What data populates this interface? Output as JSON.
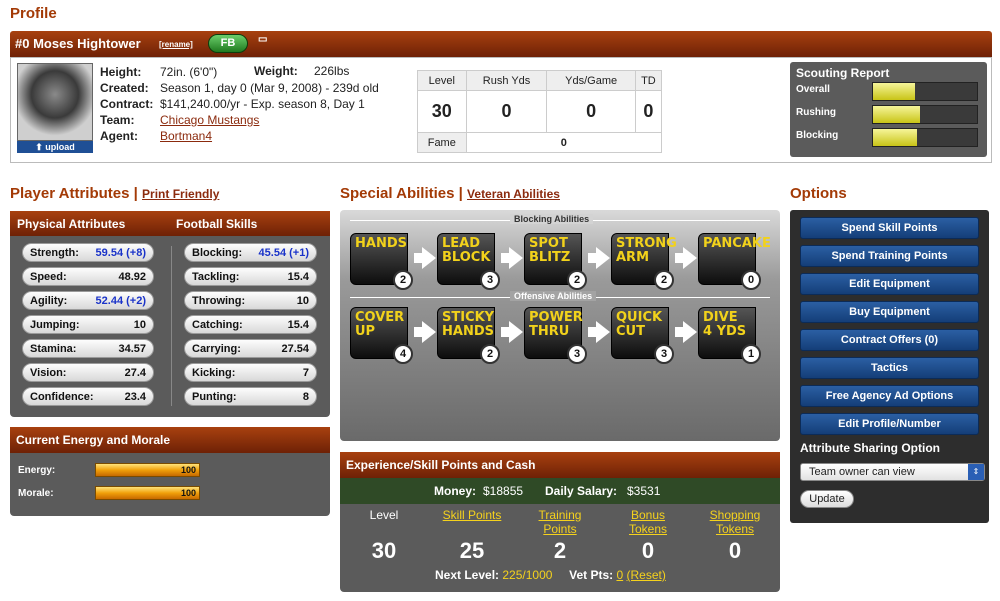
{
  "page_title": "Profile",
  "player": {
    "name": "#0 Moses Hightower",
    "rename": "[rename]",
    "position": "FB",
    "height_label": "Height:",
    "height": "72in. (6'0\")",
    "weight_label": "Weight:",
    "weight": "226lbs",
    "created_label": "Created:",
    "created": "Season 1, day 0 (Mar 9, 2008) - 239d old",
    "contract_label": "Contract:",
    "contract": "$141,240.00/yr - Exp. season 8, Day 1",
    "team_label": "Team:",
    "team": "Chicago Mustangs",
    "agent_label": "Agent:",
    "agent": "Bortman4",
    "upload": "upload"
  },
  "stats": {
    "headers": [
      "Level",
      "Rush Yds",
      "Yds/Game",
      "TD"
    ],
    "values": [
      "30",
      "0",
      "0",
      "0"
    ],
    "fame_label": "Fame",
    "fame": "0"
  },
  "scouting": {
    "title": "Scouting Report",
    "rows": [
      {
        "label": "Overall",
        "level": 0.4
      },
      {
        "label": "Rushing",
        "level": 0.45
      },
      {
        "label": "Blocking",
        "level": 0.42
      }
    ]
  },
  "attributes": {
    "title": "Player Attributes",
    "print": "Print Friendly",
    "physical_title": "Physical Attributes",
    "skills_title": "Football Skills",
    "physical": [
      {
        "label": "Strength:",
        "value": "59.54 (+8)",
        "blue": true
      },
      {
        "label": "Speed:",
        "value": "48.92"
      },
      {
        "label": "Agility:",
        "value": "52.44 (+2)",
        "blue": true
      },
      {
        "label": "Jumping:",
        "value": "10"
      },
      {
        "label": "Stamina:",
        "value": "34.57"
      },
      {
        "label": "Vision:",
        "value": "27.4"
      },
      {
        "label": "Confidence:",
        "value": "23.4"
      }
    ],
    "skills": [
      {
        "label": "Blocking:",
        "value": "45.54 (+1)",
        "blue": true
      },
      {
        "label": "Tackling:",
        "value": "15.4"
      },
      {
        "label": "Throwing:",
        "value": "10"
      },
      {
        "label": "Catching:",
        "value": "15.4"
      },
      {
        "label": "Carrying:",
        "value": "27.54"
      },
      {
        "label": "Kicking:",
        "value": "7"
      },
      {
        "label": "Punting:",
        "value": "8"
      }
    ]
  },
  "energy": {
    "title": "Current Energy and Morale",
    "energy_label": "Energy:",
    "energy": "100",
    "morale_label": "Morale:",
    "morale": "100"
  },
  "abilities": {
    "title": "Special Abilities",
    "veteran": "Veteran Abilities",
    "blocking_title": "Blocking Abilities",
    "offensive_title": "Offensive Abilities",
    "blocking": [
      {
        "l1": "Hands",
        "l2": "",
        "n": "2"
      },
      {
        "l1": "Lead",
        "l2": "Block",
        "n": "3"
      },
      {
        "l1": "Spot",
        "l2": "Blitz",
        "n": "2"
      },
      {
        "l1": "Strong",
        "l2": "Arm",
        "n": "2"
      },
      {
        "l1": "Pancake",
        "l2": "",
        "n": "0"
      }
    ],
    "offensive": [
      {
        "l1": "Cover",
        "l2": "Up",
        "n": "4"
      },
      {
        "l1": "Sticky",
        "l2": "Hands",
        "n": "2"
      },
      {
        "l1": "Power",
        "l2": "Thru",
        "n": "3"
      },
      {
        "l1": "Quick",
        "l2": "Cut",
        "n": "3"
      },
      {
        "l1": "Dive",
        "l2": "4 Yds",
        "n": "1"
      }
    ]
  },
  "experience": {
    "title": "Experience/Skill Points and Cash",
    "money_label": "Money:",
    "money": "$18855",
    "salary_label": "Daily Salary:",
    "salary": "$3531",
    "level_label": "Level",
    "skill_label": "Skill Points",
    "training_label1": "Training",
    "training_label2": "Points",
    "bonus_label1": "Bonus",
    "bonus_label2": "Tokens",
    "shopping_label1": "Shopping",
    "shopping_label2": "Tokens",
    "level": "30",
    "skill": "25",
    "training": "2",
    "bonus": "0",
    "shopping": "0",
    "next_label": "Next Level:",
    "next": "225/1000",
    "vet_label": "Vet Pts:",
    "vet": "0",
    "reset": "(Reset)"
  },
  "options": {
    "title": "Options",
    "buttons": [
      "Spend Skill Points",
      "Spend Training Points",
      "Edit Equipment",
      "Buy Equipment",
      "Contract Offers (0)",
      "Tactics",
      "Free Agency Ad Options",
      "Edit Profile/Number"
    ],
    "sharing_title": "Attribute Sharing Option",
    "sharing_value": "Team owner can view",
    "update": "Update"
  }
}
